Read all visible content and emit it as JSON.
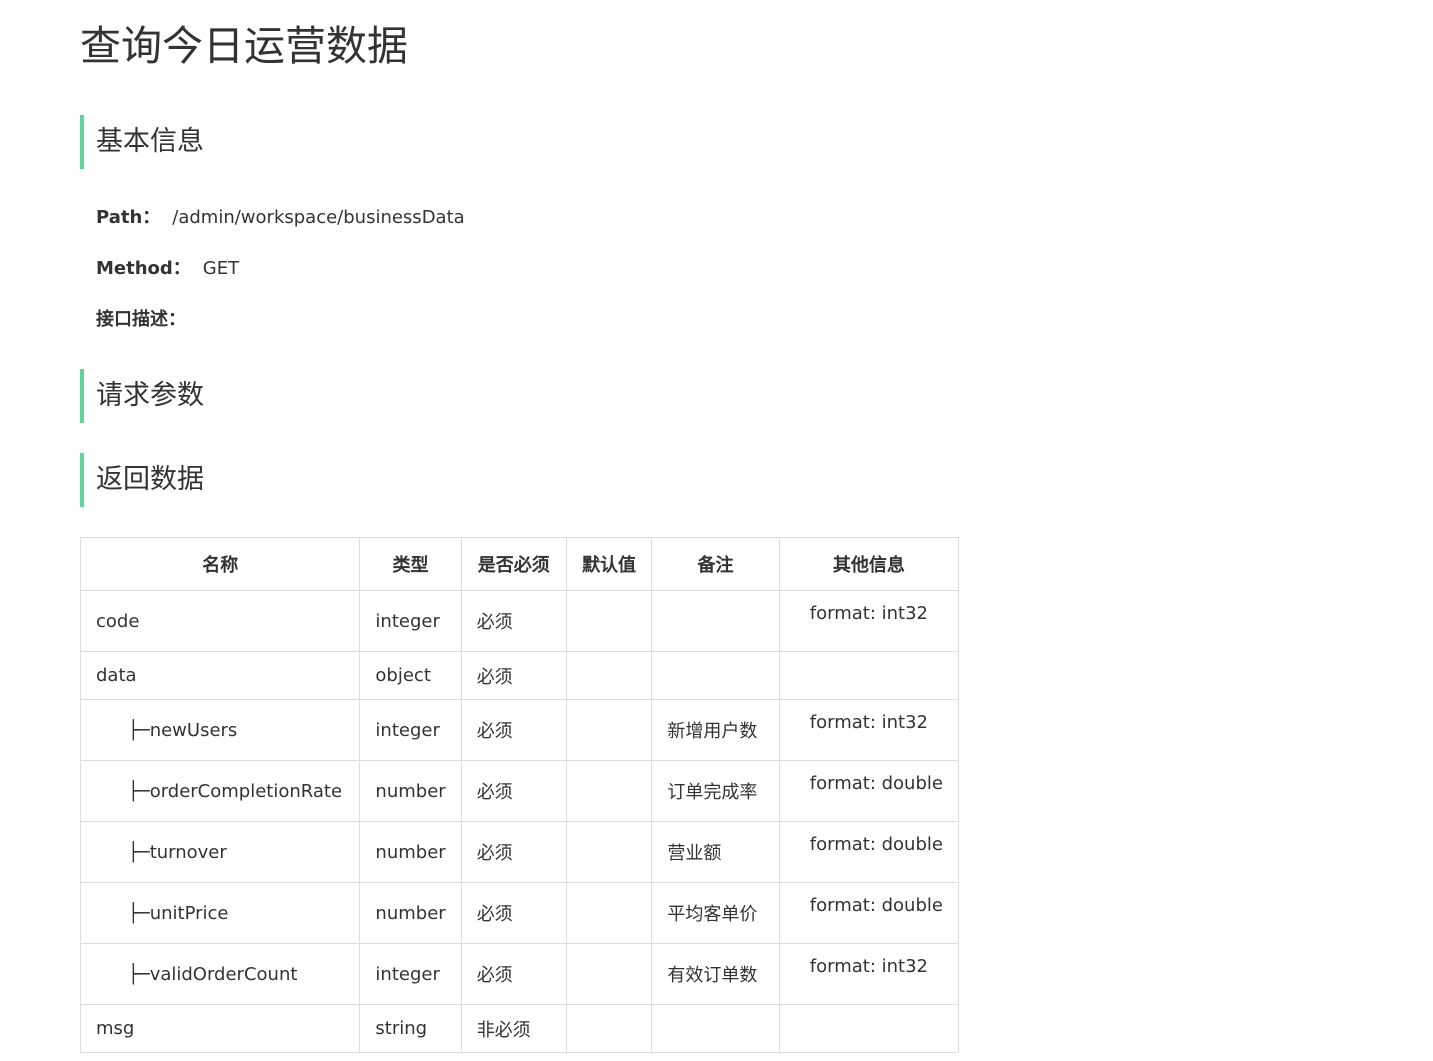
{
  "page": {
    "title": "查询今日运营数据"
  },
  "basic_info": {
    "heading": "基本信息",
    "path_label": "Path：",
    "path_value": "/admin/workspace/businessData",
    "method_label": "Method：",
    "method_value": "GET",
    "desc_label": "接口描述："
  },
  "request_params": {
    "heading": "请求参数"
  },
  "response_data": {
    "heading": "返回数据",
    "columns": [
      "名称",
      "类型",
      "是否必须",
      "默认值",
      "备注",
      "其他信息"
    ],
    "rows": [
      {
        "prefix": "",
        "name": "code",
        "type": "integer",
        "required": "必须",
        "default": "",
        "note": "",
        "other": "format: int32"
      },
      {
        "prefix": "",
        "name": "data",
        "type": "object",
        "required": "必须",
        "default": "",
        "note": "",
        "other": ""
      },
      {
        "prefix": "├─",
        "name": "newUsers",
        "type": "integer",
        "required": "必须",
        "default": "",
        "note": "新增用户数",
        "other": "format: int32"
      },
      {
        "prefix": "├─",
        "name": "orderCompletionRate",
        "type": "number",
        "required": "必须",
        "default": "",
        "note": "订单完成率",
        "other": "format: double"
      },
      {
        "prefix": "├─",
        "name": "turnover",
        "type": "number",
        "required": "必须",
        "default": "",
        "note": "营业额",
        "other": "format: double"
      },
      {
        "prefix": "├─",
        "name": "unitPrice",
        "type": "number",
        "required": "必须",
        "default": "",
        "note": "平均客单价",
        "other": "format: double"
      },
      {
        "prefix": "├─",
        "name": "validOrderCount",
        "type": "integer",
        "required": "必须",
        "default": "",
        "note": "有效订单数",
        "other": "format: int32"
      },
      {
        "prefix": "",
        "name": "msg",
        "type": "string",
        "required": "非必须",
        "default": "",
        "note": "",
        "other": ""
      }
    ]
  }
}
